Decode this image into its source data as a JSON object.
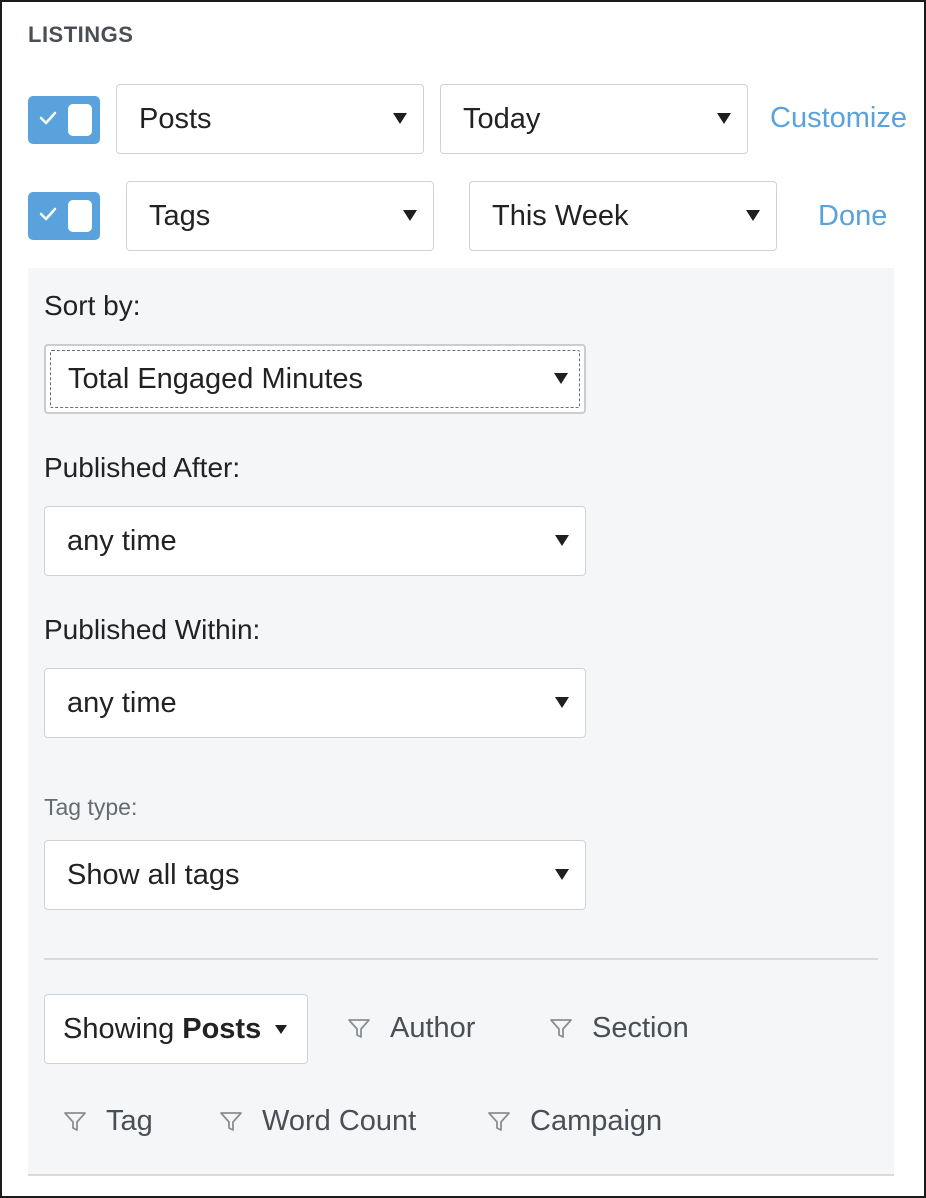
{
  "header": {
    "title": "LISTINGS"
  },
  "rows": [
    {
      "enabled": true,
      "type": "Posts",
      "period": "Today",
      "action": "Customize"
    },
    {
      "enabled": true,
      "type": "Tags",
      "period": "This Week",
      "action": "Done"
    }
  ],
  "panel": {
    "sort_label": "Sort by:",
    "sort_value": "Total Engaged Minutes",
    "published_after_label": "Published After:",
    "published_after_value": "any time",
    "published_within_label": "Published Within:",
    "published_within_value": "any time",
    "tag_type_label": "Tag type:",
    "tag_type_value": "Show all tags",
    "showing": {
      "prefix": "Showing",
      "value": "Posts"
    },
    "filters": [
      "Author",
      "Section",
      "Tag",
      "Word Count",
      "Campaign"
    ]
  },
  "colors": {
    "accent": "#5aa2dc",
    "panel_bg": "#f5f6f8"
  },
  "icons": {
    "toggle_check": "check-icon",
    "filter": "filter-funnel-icon",
    "dropdown": "triangle-down-icon"
  }
}
